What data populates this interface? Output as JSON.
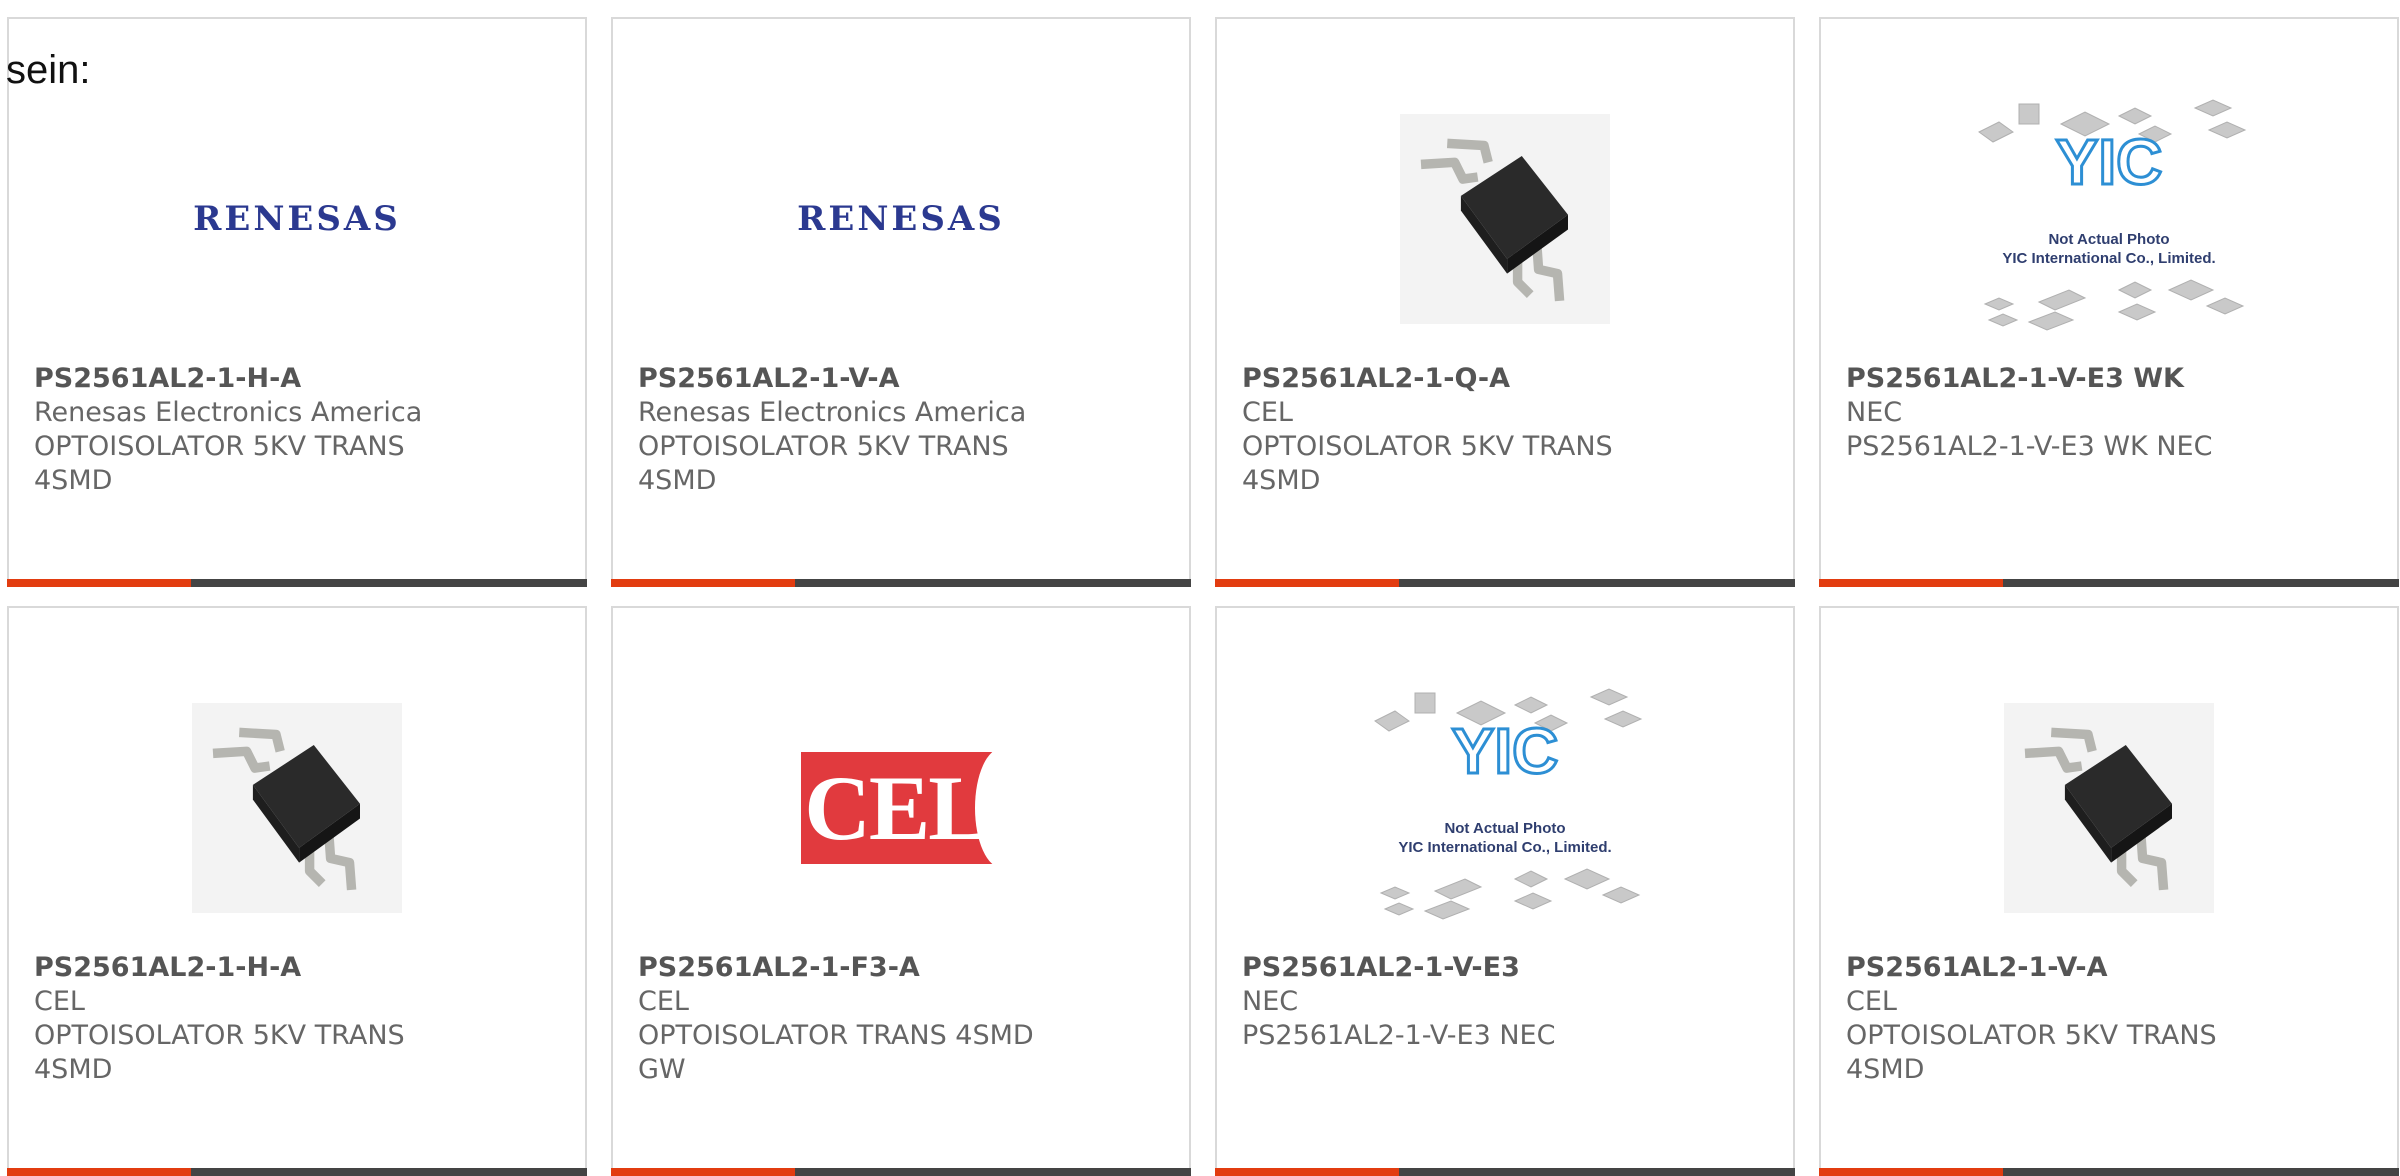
{
  "intro_text": "sein:",
  "colors": {
    "accent": "#e23c10",
    "bar": "#444444",
    "title": "#555555",
    "text": "#666666"
  },
  "placeholder": {
    "line1": "Not Actual Photo",
    "line2": "YIC International Co., Limited.",
    "logo": "YIC"
  },
  "logos": {
    "renesas": "RENESAS",
    "cel": "CEL"
  },
  "products": [
    {
      "image": "renesas-logo",
      "part": "PS2561AL2-1-H-A",
      "maker": "Renesas Electronics America",
      "desc1": "OPTOISOLATOR 5KV TRANS",
      "desc2": "4SMD"
    },
    {
      "image": "renesas-logo",
      "part": "PS2561AL2-1-V-A",
      "maker": "Renesas Electronics America",
      "desc1": "OPTOISOLATOR 5KV TRANS",
      "desc2": "4SMD"
    },
    {
      "image": "chip-photo",
      "part": "PS2561AL2-1-Q-A",
      "maker": "CEL",
      "desc1": "OPTOISOLATOR 5KV TRANS",
      "desc2": "4SMD"
    },
    {
      "image": "yic-placeholder",
      "part": "PS2561AL2-1-V-E3 WK",
      "maker": "NEC",
      "desc1": "PS2561AL2-1-V-E3 WK NEC",
      "desc2": ""
    },
    {
      "image": "chip-photo",
      "part": "PS2561AL2-1-H-A",
      "maker": "CEL",
      "desc1": "OPTOISOLATOR 5KV TRANS",
      "desc2": "4SMD"
    },
    {
      "image": "cel-logo",
      "part": "PS2561AL2-1-F3-A",
      "maker": "CEL",
      "desc1": "OPTOISOLATOR TRANS 4SMD",
      "desc2": "GW"
    },
    {
      "image": "yic-placeholder",
      "part": "PS2561AL2-1-V-E3",
      "maker": "NEC",
      "desc1": "PS2561AL2-1-V-E3 NEC",
      "desc2": ""
    },
    {
      "image": "chip-photo",
      "part": "PS2561AL2-1-V-A",
      "maker": "CEL",
      "desc1": "OPTOISOLATOR 5KV TRANS",
      "desc2": "4SMD"
    }
  ]
}
